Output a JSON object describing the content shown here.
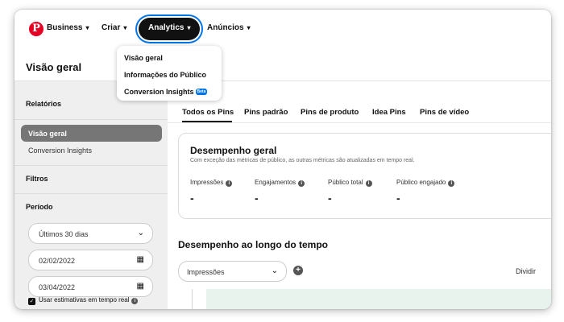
{
  "nav": {
    "logo_glyph": "P",
    "business": "Business",
    "criar": "Criar",
    "analytics": "Analytics",
    "anuncios": "Anúncios",
    "chevron": "▾"
  },
  "dropdown": {
    "items": [
      "Visão geral",
      "Informações do Público",
      "Conversion Insights"
    ],
    "beta_badge": "Beta"
  },
  "page": {
    "title": "Visão geral"
  },
  "sidebar": {
    "relatorios": "Relatórios",
    "items": [
      "Visão geral",
      "Conversion Insights"
    ],
    "filtros": "Filtros",
    "periodo": "Período",
    "period_select": "Últimos 30 dias",
    "start_date": "02/02/2022",
    "end_date": "03/04/2022",
    "realtime_checkbox": "Usar estimativas em tempo real",
    "realtime_checked": true
  },
  "tabs": [
    "Todos os Pins",
    "Pins padrão",
    "Pins de produto",
    "Idea Pins",
    "Pins de vídeo"
  ],
  "overview_card": {
    "title": "Desempenho geral",
    "subtitle": "Com exceção das métricas de público, as outras métricas são atualizadas em tempo real.",
    "metrics": [
      {
        "label": "Impressões",
        "value": "-"
      },
      {
        "label": "Engajamentos",
        "value": "-"
      },
      {
        "label": "Público total",
        "value": "-"
      },
      {
        "label": "Público engajado",
        "value": "-"
      }
    ]
  },
  "performance": {
    "title": "Desempenho ao longo do tempo",
    "metric_select": "Impressões",
    "split_label": "Dividir"
  },
  "colors": {
    "brand": "#e60023",
    "focus_ring": "#0074e8",
    "active_item": "#767676",
    "chart_fill": "#e8f3ee"
  },
  "icons": {
    "chevron": "chevron-down-icon",
    "calendar": "calendar-icon",
    "info": "info-icon",
    "add": "plus-circle-icon",
    "check": "checkbox-checked-icon"
  }
}
